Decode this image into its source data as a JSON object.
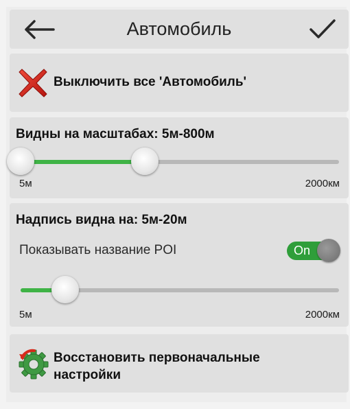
{
  "header": {
    "title": "Автомобиль",
    "back_icon": "arrow-left-icon",
    "confirm_icon": "checkmark-icon"
  },
  "disable_all": {
    "label": "Выключить все 'Автомобиль'",
    "icon": "red-x-icon",
    "icon_color": "#d9261c"
  },
  "visibility_scale": {
    "title": "Видны на масштабах: 5м-800м",
    "min_label": "5м",
    "max_label": "2000км",
    "selected_from": "5м",
    "selected_to": "800м",
    "fill_fraction": 0.39
  },
  "label_scale": {
    "title": "Надпись видна на: 5м-20м",
    "poi_toggle_label": "Показывать название POI",
    "poi_toggle_state": "On",
    "min_label": "5м",
    "max_label": "2000км",
    "selected_from": "5м",
    "selected_to": "20м",
    "fill_fraction": 0.14
  },
  "restore": {
    "label": "Восстановить первоначальные настройки",
    "icon": "restore-gear-icon"
  },
  "colors": {
    "accent_green": "#3fb346",
    "toggle_green": "#2f9e3a",
    "card_bg": "#e0e0e0",
    "track_gray": "#b8b8b8"
  }
}
